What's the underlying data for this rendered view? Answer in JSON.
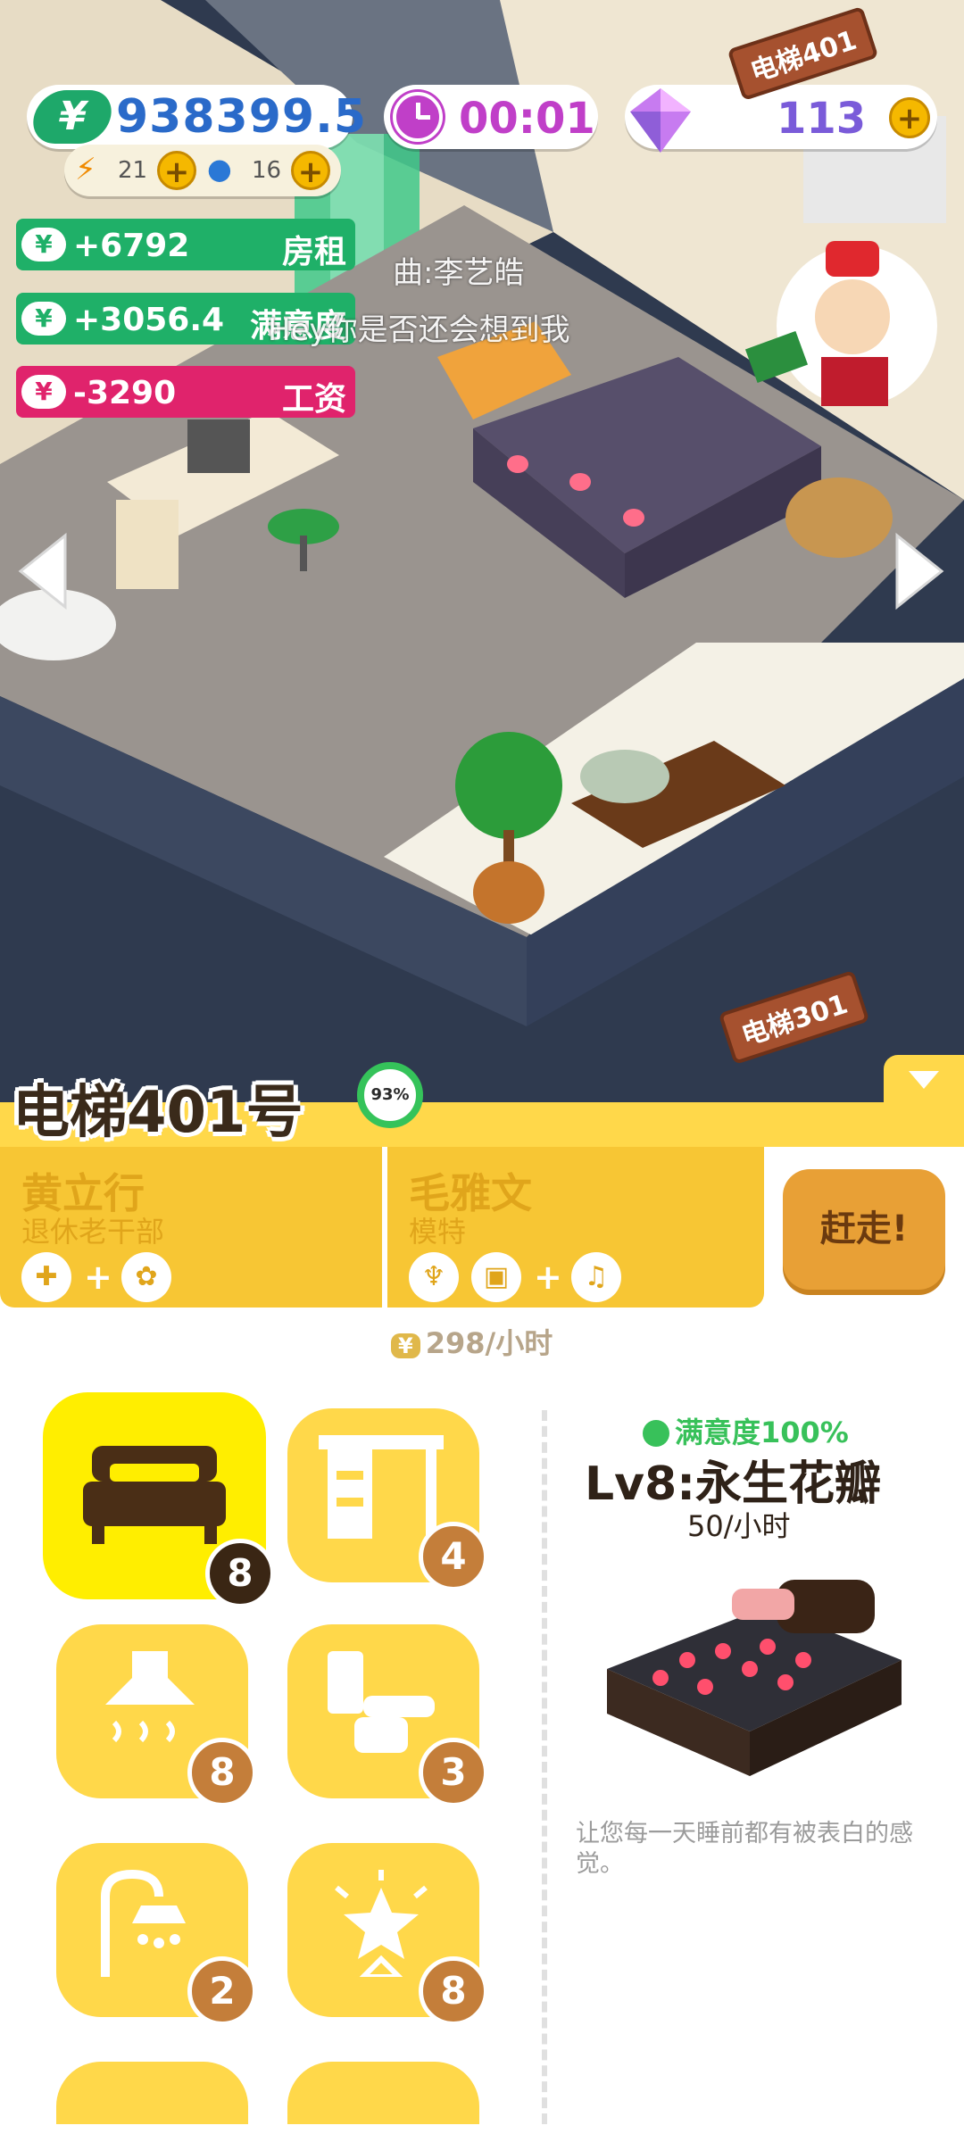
{
  "hud": {
    "money": "938399.5",
    "money_symbol": "¥",
    "energy": "21",
    "water": "16",
    "timer": "00:01",
    "gems": "113"
  },
  "income": [
    {
      "value": "+6792",
      "label": "房租",
      "color": "#1fb068"
    },
    {
      "value": "+3056.4",
      "label": "满意度",
      "color": "#1fb068"
    },
    {
      "value": "-3290",
      "label": "工资",
      "color": "#e0236c"
    }
  ],
  "watermark": {
    "line1": "曲:李艺皓",
    "line2": "Hey你是否还会想到我"
  },
  "signs": {
    "upper": "电梯401",
    "lower": "电梯301"
  },
  "room": {
    "title": "电梯401号",
    "percent": "93%"
  },
  "tenants": [
    {
      "name": "黄立行",
      "job": "退休老干部",
      "needs": [
        "medical-icon",
        "plant-icon"
      ]
    },
    {
      "name": "毛雅文",
      "job": "模特",
      "needs": [
        "food-icon",
        "box-icon",
        "music-icon"
      ]
    }
  ],
  "evict_label": "赶走!",
  "rent_rate": "298/小时",
  "furniture": [
    {
      "icon": "bed-icon",
      "level": "8",
      "selected": true
    },
    {
      "icon": "desk-icon",
      "level": "4"
    },
    {
      "icon": "range-hood-icon",
      "level": "8"
    },
    {
      "icon": "toilet-icon",
      "level": "3"
    },
    {
      "icon": "shower-icon",
      "level": "2"
    },
    {
      "icon": "lamp-icon",
      "level": "8"
    }
  ],
  "detail": {
    "satisfaction": "满意度100%",
    "name": "Lv8:永生花瓣",
    "rate": "50/小时",
    "description": "让您每一天睡前都有被表白的感觉。"
  },
  "colors": {
    "accent_yellow": "#ffd84a",
    "money_green": "#1ea86a",
    "timer_purple": "#c03fc8"
  }
}
